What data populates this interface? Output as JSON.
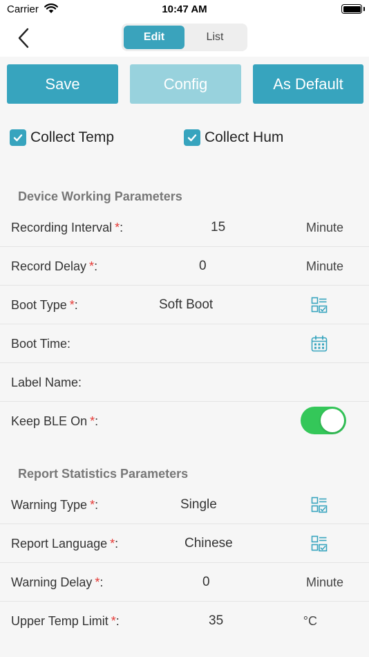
{
  "status_bar": {
    "carrier": "Carrier",
    "time": "10:47 AM"
  },
  "nav": {
    "tabs": [
      {
        "label": "Edit",
        "active": true
      },
      {
        "label": "List",
        "active": false
      }
    ]
  },
  "actions": {
    "save": "Save",
    "config": "Config",
    "as_default": "As Default"
  },
  "checks": [
    {
      "label": "Collect Temp",
      "checked": true
    },
    {
      "label": "Collect Hum",
      "checked": true
    }
  ],
  "device_section": {
    "title": "Device Working Parameters",
    "rows": [
      {
        "label": "Recording Interval",
        "required": "*",
        "colon": ":",
        "value": "15",
        "unit": "Minute"
      },
      {
        "label": "Record Delay",
        "required": "*",
        "colon": ":",
        "value": "0",
        "unit": "Minute"
      },
      {
        "label": "Boot Type",
        "required": "*",
        "colon": ":",
        "value": "Soft Boot",
        "icon": "list-select-icon"
      },
      {
        "label": "Boot Time:",
        "icon": "calendar-icon"
      },
      {
        "label": "Label Name:"
      },
      {
        "label": "Keep BLE On",
        "required": "*",
        "colon": ":",
        "toggle": true
      }
    ]
  },
  "report_section": {
    "title": "Report Statistics Parameters",
    "rows": [
      {
        "label": "Warning Type",
        "required": "*",
        "colon": ":",
        "value": "Single",
        "icon": "list-select-icon"
      },
      {
        "label": "Report Language",
        "required": "*",
        "colon": ":",
        "value": "Chinese",
        "icon": "list-select-icon"
      },
      {
        "label": "Warning Delay",
        "required": "*",
        "colon": ":",
        "value": "0",
        "unit": "Minute"
      },
      {
        "label": "Upper Temp Limit",
        "required": "*",
        "colon": ":",
        "value": "35",
        "unit": "°C"
      }
    ]
  },
  "colors": {
    "accent": "#37a4be",
    "accent_disabled": "#98d2dd",
    "toggle_on": "#34c759",
    "required": "#e53935"
  }
}
